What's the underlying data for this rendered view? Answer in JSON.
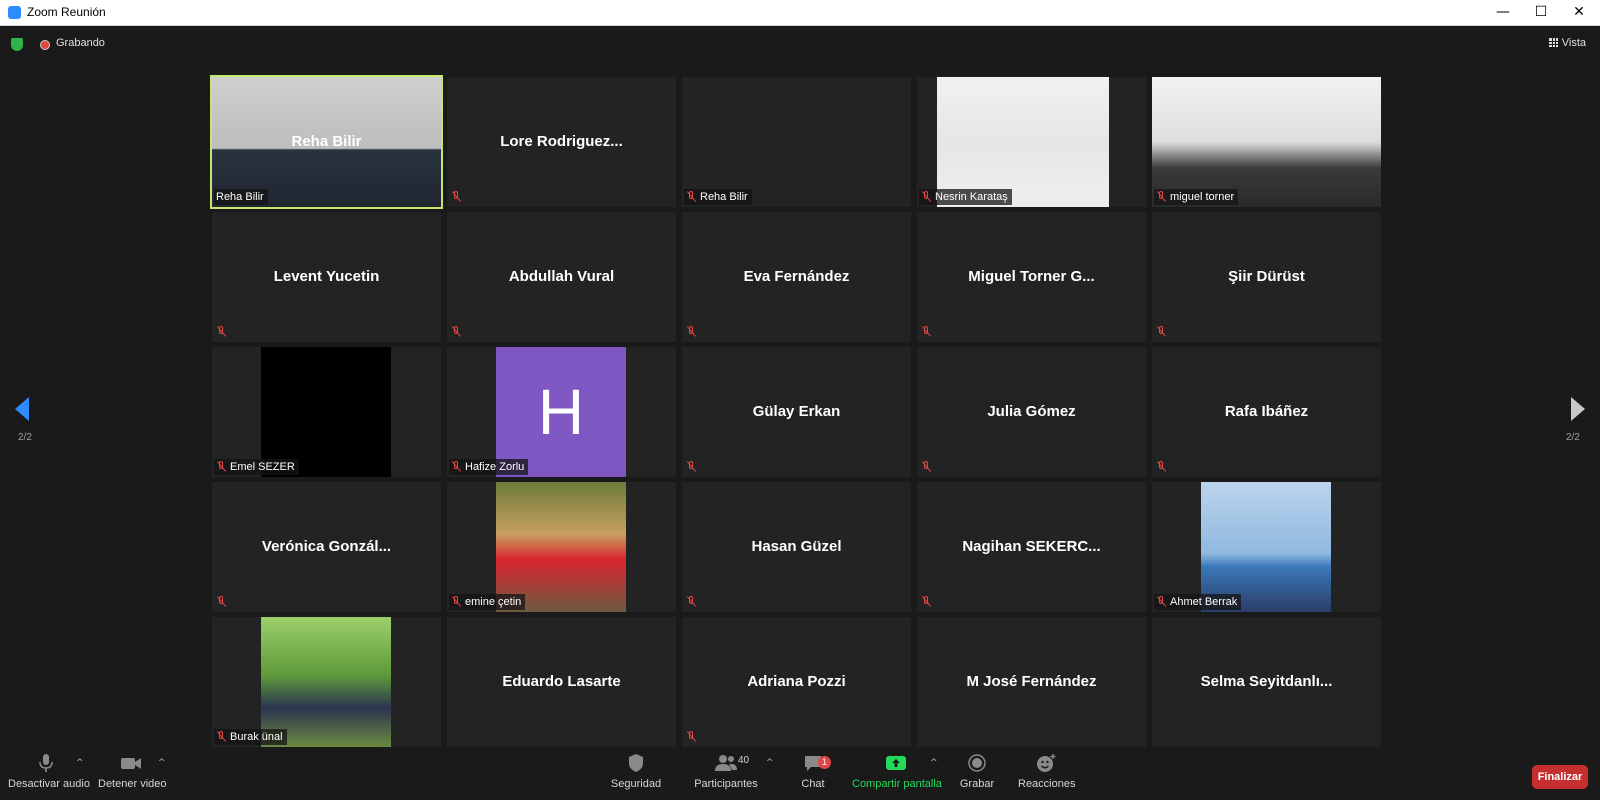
{
  "window": {
    "title": "Zoom Reunión",
    "controls": [
      "—",
      "☐",
      "✕"
    ]
  },
  "topbar": {
    "recording_label": "Grabando",
    "view_label": "Vista"
  },
  "pager": {
    "left": "2/2",
    "right": "2/2"
  },
  "participants": [
    {
      "name": "Reha Bilir",
      "label": "Reha Bilir",
      "video": true,
      "muted": false,
      "active": true
    },
    {
      "name": "Lore  Rodriguez...",
      "label": "",
      "video": false,
      "muted": true
    },
    {
      "name": "",
      "label": "Reha Bilir",
      "video": false,
      "muted": true
    },
    {
      "name": "",
      "label": "Nesrin Karataş",
      "video": true,
      "muted": true
    },
    {
      "name": "",
      "label": "miguel torner",
      "video": true,
      "muted": true
    },
    {
      "name": "Levent Yucetin",
      "label": "",
      "video": false,
      "muted": true
    },
    {
      "name": "Abdullah Vural",
      "label": "",
      "video": false,
      "muted": true
    },
    {
      "name": "Eva Fernández",
      "label": "",
      "video": false,
      "muted": true
    },
    {
      "name": "Miguel Torner G...",
      "label": "",
      "video": false,
      "muted": true
    },
    {
      "name": "Şiir Dürüst",
      "label": "",
      "video": false,
      "muted": true
    },
    {
      "name": "",
      "label": "Emel SEZER",
      "video": true,
      "muted": true
    },
    {
      "name": "",
      "label": "Hafize Zorlu",
      "video": true,
      "muted": true,
      "avatar_letter": "H"
    },
    {
      "name": "Gülay Erkan",
      "label": "",
      "video": false,
      "muted": true
    },
    {
      "name": "Julia Gómez",
      "label": "",
      "video": false,
      "muted": true
    },
    {
      "name": "Rafa Ibáñez",
      "label": "",
      "video": false,
      "muted": true
    },
    {
      "name": "Verónica  Gonzál...",
      "label": "",
      "video": false,
      "muted": true
    },
    {
      "name": "",
      "label": "emine çetin",
      "video": true,
      "muted": true
    },
    {
      "name": "Hasan Güzel",
      "label": "",
      "video": false,
      "muted": true
    },
    {
      "name": "Nagihan  SEKERC...",
      "label": "",
      "video": false,
      "muted": true
    },
    {
      "name": "",
      "label": "Ahmet Berrak",
      "video": true,
      "muted": true
    },
    {
      "name": "",
      "label": "Burak ünal",
      "video": true,
      "muted": true
    },
    {
      "name": "Eduardo Lasarte",
      "label": "",
      "video": false,
      "muted": false
    },
    {
      "name": "Adriana Pozzi",
      "label": "",
      "video": false,
      "muted": true
    },
    {
      "name": "M José Fernández",
      "label": "",
      "video": false,
      "muted": false
    },
    {
      "name": "Selma  Seyitdanlı...",
      "label": "",
      "video": false,
      "muted": false
    }
  ],
  "toolbar": {
    "audio": "Desactivar audio",
    "video": "Detener video",
    "security": "Seguridad",
    "participants": "Participantes",
    "participants_count": "40",
    "chat": "Chat",
    "chat_badge": "1",
    "share": "Compartir pantalla",
    "record": "Grabar",
    "reactions": "Reacciones",
    "end": "Finalizar"
  },
  "colors": {
    "accent": "#2d8cff",
    "active_speaker": "#c4e66a",
    "share_green": "#23d959",
    "end_red": "#c62f2f",
    "muted_red": "#e34646"
  }
}
